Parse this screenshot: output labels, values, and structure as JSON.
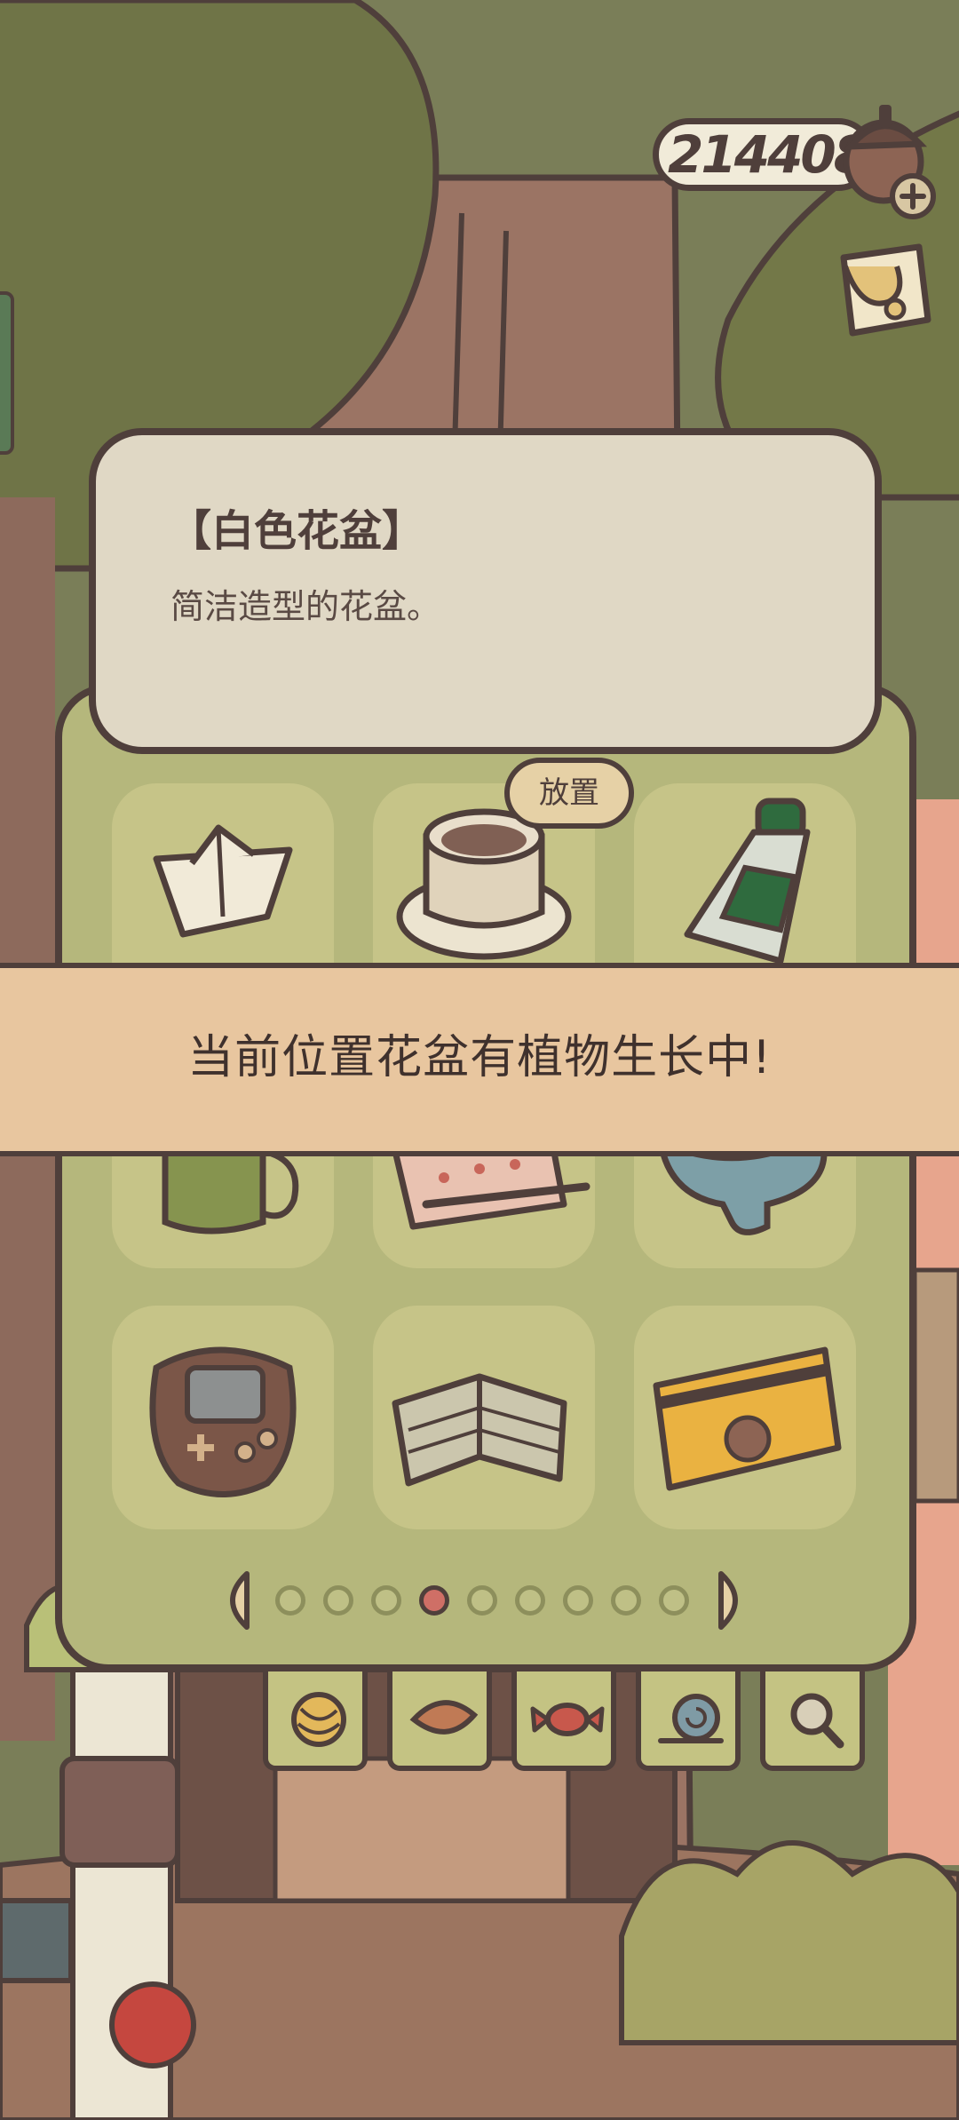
{
  "currency": {
    "amount": "214408",
    "add_icon": "plus-icon",
    "coin_icon": "acorn-icon"
  },
  "top_right_button": {
    "icon": "letter-icon"
  },
  "item_detail": {
    "title": "【白色花盆】",
    "description": "简洁造型的花盆。"
  },
  "place_button": {
    "label": "放置"
  },
  "toast": {
    "message": "当前位置花盆有植物生长中!"
  },
  "inventory": {
    "items": [
      {
        "name": "paper-boat-icon"
      },
      {
        "name": "white-flowerpot-icon",
        "selected": true
      },
      {
        "name": "water-bottle-icon"
      },
      {
        "name": "green-mug-icon"
      },
      {
        "name": "pencil-notepad-icon"
      },
      {
        "name": "bone-toy-icon"
      },
      {
        "name": "handheld-game-icon"
      },
      {
        "name": "cookie-book-icon"
      },
      {
        "name": "acorn-card-icon"
      }
    ]
  },
  "pagination": {
    "total_pages": 9,
    "current_page": 4
  },
  "tabs": [
    {
      "name": "yarn-ball-icon"
    },
    {
      "name": "leaf-dish-icon"
    },
    {
      "name": "candy-icon"
    },
    {
      "name": "snail-icon"
    },
    {
      "name": "magnifier-icon"
    }
  ],
  "colors": {
    "outline": "#4f3f3b",
    "panel": "#b5b77c",
    "card": "#e0d8c5",
    "toast": "#e8c69f",
    "active_dot": "#cf6f66"
  }
}
